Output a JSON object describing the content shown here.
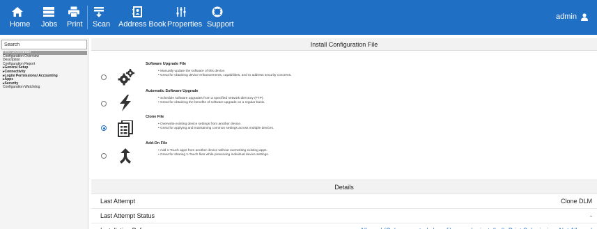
{
  "nav": {
    "home": "Home",
    "jobs": "Jobs",
    "print": "Print",
    "scan": "Scan",
    "address_book": "Address Book",
    "properties": "Properties",
    "support": "Support"
  },
  "user": {
    "name": "admin"
  },
  "sidebar": {
    "search_value": "Search",
    "items": [
      "Fleet Orchestrator",
      "Configuration Overview",
      "Description",
      "Configuration Report",
      "▸General Setup",
      "▸Connectivity",
      "▸Login/ Permissions/ Accounting",
      "▸Apps",
      "▸Security",
      "Configuration Watchdog"
    ]
  },
  "main": {
    "title": "Install Configuration File",
    "options": [
      {
        "title": "Software Upgrade File",
        "lines": [
          "•  Manually update the software of this device.",
          "•  Great for obtaining device enhancements, capabilities, and to address security concerns."
        ]
      },
      {
        "title": "Automatic Software Upgrade",
        "lines": [
          "•  Schedule software upgrades from a specified network directory (FTP).",
          "•  Great for obtaining the benefits of software upgrade on a regular basis."
        ]
      },
      {
        "title": "Clone File",
        "lines": [
          "•  Overwrite existing device settings from another device.",
          "•  Great for applying and maintaining common settings across multiple devices."
        ]
      },
      {
        "title": "Add-On File",
        "lines": [
          "•  Add 1-Touch apps from another device without overwriting existing apps.",
          "•  Great for sharing 1-Touch files while preserving individual device settings."
        ]
      }
    ],
    "selected_option": "Clone File",
    "details": {
      "title": "Details",
      "rows": [
        {
          "label": "Last Attempt",
          "value": "Clone DLM"
        },
        {
          "label": "Last Attempt Status",
          "value": "-"
        },
        {
          "label": "Installation Policy",
          "value": "Allowed (Only encrypted clone files can be installed); Print Submission: Not Allowed"
        }
      ]
    }
  },
  "colors": {
    "accent": "#1f6fc5",
    "icon": "#333333"
  },
  "icons": {
    "home": "home-icon",
    "jobs": "jobs-icon",
    "print": "printer-icon",
    "scan": "scan-icon",
    "address_book": "address-book-icon",
    "properties": "sliders-icon",
    "support": "lifebuoy-icon",
    "user": "user-icon"
  }
}
